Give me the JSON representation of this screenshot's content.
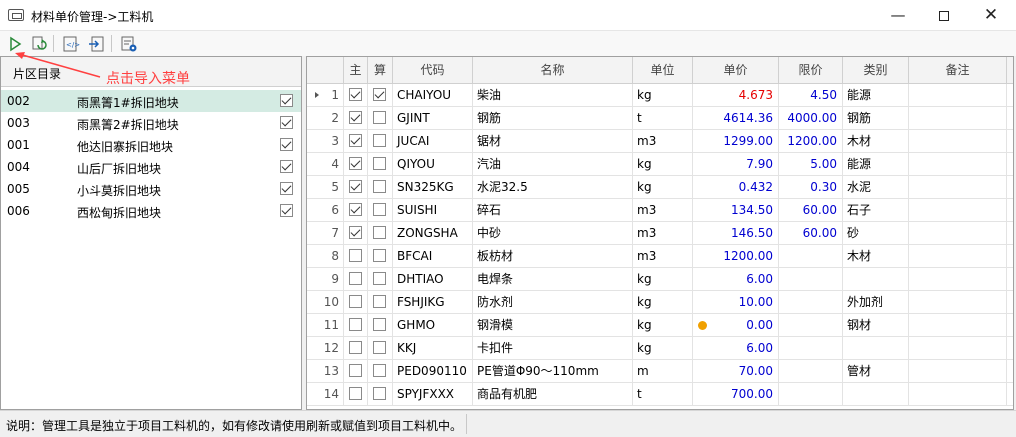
{
  "window": {
    "title": "材料单价管理->工料机",
    "minimize_symbol": "—",
    "close_symbol": "✕"
  },
  "toolbar": {
    "buttons": [
      "run-icon",
      "refresh-icon",
      "import-icon",
      "export-icon",
      "settings-icon"
    ]
  },
  "left_panel": {
    "header": "片区目录",
    "annotation": "点击导入菜单",
    "items": [
      {
        "code": "002",
        "name": "雨黑箐1#拆旧地块",
        "checked": true,
        "selected": true
      },
      {
        "code": "003",
        "name": "雨黑箐2#拆旧地块",
        "checked": true,
        "selected": false
      },
      {
        "code": "001",
        "name": "他达旧寨拆旧地块",
        "checked": true,
        "selected": false
      },
      {
        "code": "004",
        "name": "山后厂拆旧地块",
        "checked": true,
        "selected": false
      },
      {
        "code": "005",
        "name": "小斗莫拆旧地块",
        "checked": true,
        "selected": false
      },
      {
        "code": "006",
        "name": "西松甸拆旧地块",
        "checked": true,
        "selected": false
      }
    ]
  },
  "grid": {
    "columns": [
      "",
      "主",
      "算",
      "代码",
      "名称",
      "单位",
      "单价",
      "限价",
      "类别",
      "备注"
    ],
    "rows": [
      {
        "num": "1",
        "main": true,
        "calc": true,
        "code": "CHAIYOU",
        "name": "柴油",
        "unit": "kg",
        "price": "4.673",
        "limit": "4.50",
        "category": "能源",
        "note": "",
        "current": true,
        "price_red": true
      },
      {
        "num": "2",
        "main": true,
        "calc": false,
        "code": "GJINT",
        "name": "钢筋",
        "unit": "t",
        "price": "4614.36",
        "limit": "4000.00",
        "category": "钢筋",
        "note": ""
      },
      {
        "num": "3",
        "main": true,
        "calc": false,
        "code": "JUCAI",
        "name": "锯材",
        "unit": "m3",
        "price": "1299.00",
        "limit": "1200.00",
        "category": "木材",
        "note": ""
      },
      {
        "num": "4",
        "main": true,
        "calc": false,
        "code": "QIYOU",
        "name": "汽油",
        "unit": "kg",
        "price": "7.90",
        "limit": "5.00",
        "category": "能源",
        "note": ""
      },
      {
        "num": "5",
        "main": true,
        "calc": false,
        "code": "SN325KG",
        "name": "水泥32.5",
        "unit": "kg",
        "price": "0.432",
        "limit": "0.30",
        "category": "水泥",
        "note": ""
      },
      {
        "num": "6",
        "main": true,
        "calc": false,
        "code": "SUISHI",
        "name": "碎石",
        "unit": "m3",
        "price": "134.50",
        "limit": "60.00",
        "category": "石子",
        "note": ""
      },
      {
        "num": "7",
        "main": true,
        "calc": false,
        "code": "ZONGSHA",
        "name": "中砂",
        "unit": "m3",
        "price": "146.50",
        "limit": "60.00",
        "category": "砂",
        "note": ""
      },
      {
        "num": "8",
        "main": false,
        "calc": false,
        "code": "BFCAI",
        "name": "板枋材",
        "unit": "m3",
        "price": "1200.00",
        "limit": "",
        "category": "木材",
        "note": ""
      },
      {
        "num": "9",
        "main": false,
        "calc": false,
        "code": "DHTIAO",
        "name": "电焊条",
        "unit": "kg",
        "price": "6.00",
        "limit": "",
        "category": "",
        "note": ""
      },
      {
        "num": "10",
        "main": false,
        "calc": false,
        "code": "FSHJIKG",
        "name": "防水剂",
        "unit": "kg",
        "price": "10.00",
        "limit": "",
        "category": "外加剂",
        "note": ""
      },
      {
        "num": "11",
        "main": false,
        "calc": false,
        "code": "GHMO",
        "name": "钢滑模",
        "unit": "kg",
        "price": "0.00",
        "limit": "",
        "category": "钢材",
        "note": "",
        "dot": true
      },
      {
        "num": "12",
        "main": false,
        "calc": false,
        "code": "KKJ",
        "name": "卡扣件",
        "unit": "kg",
        "price": "6.00",
        "limit": "",
        "category": "",
        "note": ""
      },
      {
        "num": "13",
        "main": false,
        "calc": false,
        "code": "PED090110",
        "name": "PE管道Φ90～110mm",
        "unit": "m",
        "price": "70.00",
        "limit": "",
        "category": "管材",
        "note": ""
      },
      {
        "num": "14",
        "main": false,
        "calc": false,
        "code": "SPYJFXXX",
        "name": "商品有机肥",
        "unit": "t",
        "price": "700.00",
        "limit": "",
        "category": "",
        "note": ""
      }
    ]
  },
  "status": {
    "text": "说明：管理工具是独立于项目工料机的，如有修改请使用刷新或赋值到项目工料机中。"
  },
  "colors": {
    "selected_row": "#d4ebe3",
    "price_blue": "#0000d0",
    "price_red": "#e60000",
    "annotation_red": "#ff4040"
  }
}
